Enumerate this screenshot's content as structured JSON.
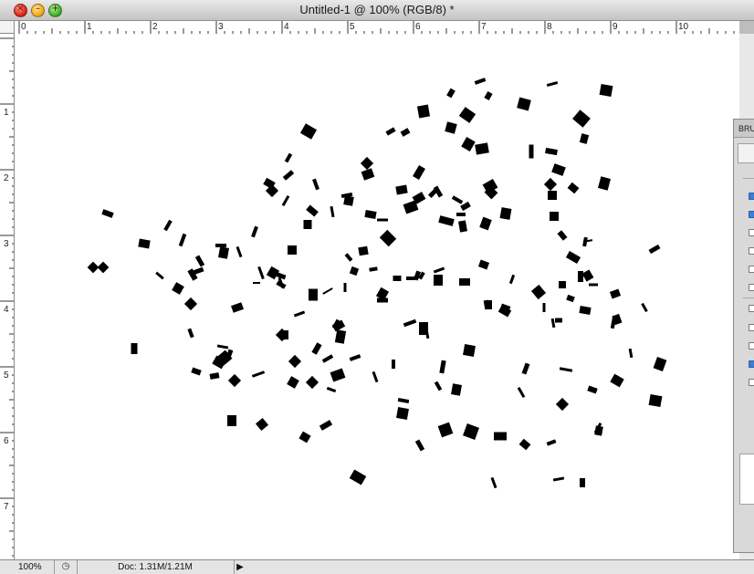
{
  "window": {
    "title": "Untitled-1 @ 100% (RGB/8) *",
    "close_glyph": "×",
    "minimize_glyph": "–",
    "zoom_glyph": "+"
  },
  "ruler": {
    "horizontal_labels": [
      "0",
      "1",
      "2",
      "3",
      "4",
      "5",
      "6",
      "7",
      "8",
      "9",
      "10"
    ],
    "vertical_labels": [
      "1",
      "2",
      "3",
      "4",
      "5",
      "6",
      "7"
    ]
  },
  "status": {
    "zoom": "100%",
    "doc": "Doc: 1.31M/1.21M",
    "arrow": "▶",
    "icon": "◷"
  },
  "panel": {
    "tab_label": "BRU",
    "checks": [
      true,
      true,
      false,
      false,
      false,
      false,
      false,
      false,
      false,
      true,
      false
    ]
  },
  "colors": {
    "stroke": "#000000",
    "canvas": "#ffffff"
  }
}
